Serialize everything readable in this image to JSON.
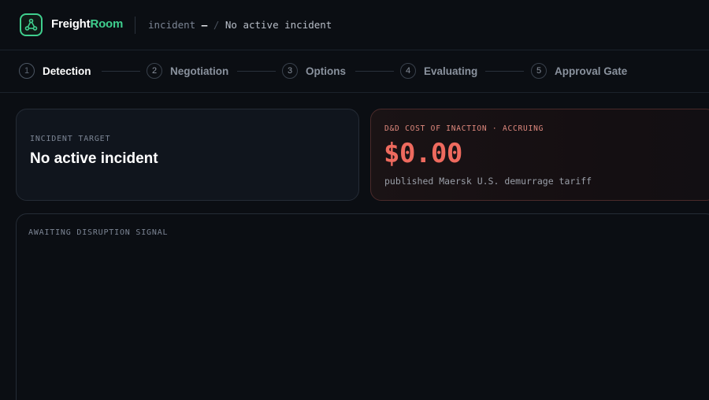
{
  "header": {
    "brand_part1": "Freight",
    "brand_part2": "Room",
    "crumb_label": "incident",
    "crumb_dash": "—",
    "crumb_sep": "/",
    "crumb_value": "No active incident",
    "brand_color": "#3fcf8e",
    "logo_icon": "network-nodes-icon"
  },
  "steps": [
    {
      "num": "1",
      "label": "Detection",
      "active": true
    },
    {
      "num": "2",
      "label": "Negotiation",
      "active": false
    },
    {
      "num": "3",
      "label": "Options",
      "active": false
    },
    {
      "num": "4",
      "label": "Evaluating",
      "active": false
    },
    {
      "num": "5",
      "label": "Approval Gate",
      "active": false
    }
  ],
  "target_card": {
    "kicker": "INCIDENT TARGET",
    "title": "No active incident"
  },
  "cost_card": {
    "kicker": "D&D COST OF INACTION · ACCRUING",
    "amount": "$0.00",
    "subtitle": "published Maersk U.S. demurrage tariff",
    "accent_color": "#ee6a5e"
  },
  "signal_panel": {
    "kicker": "AWAITING DISRUPTION SIGNAL"
  }
}
